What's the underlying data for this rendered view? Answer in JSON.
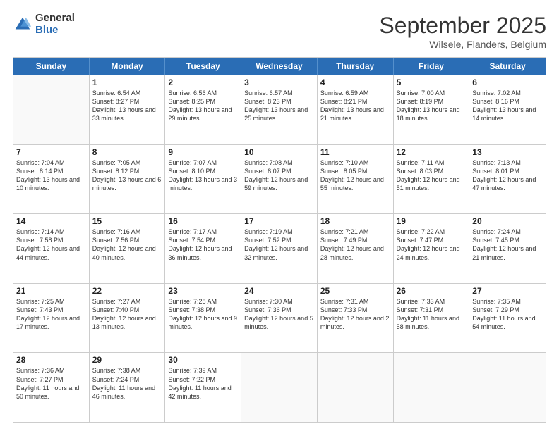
{
  "logo": {
    "general": "General",
    "blue": "Blue"
  },
  "title": {
    "month": "September 2025",
    "location": "Wilsele, Flanders, Belgium"
  },
  "days": [
    "Sunday",
    "Monday",
    "Tuesday",
    "Wednesday",
    "Thursday",
    "Friday",
    "Saturday"
  ],
  "weeks": [
    [
      {
        "day": "",
        "sunrise": "",
        "sunset": "",
        "daylight": ""
      },
      {
        "day": "1",
        "sunrise": "Sunrise: 6:54 AM",
        "sunset": "Sunset: 8:27 PM",
        "daylight": "Daylight: 13 hours and 33 minutes."
      },
      {
        "day": "2",
        "sunrise": "Sunrise: 6:56 AM",
        "sunset": "Sunset: 8:25 PM",
        "daylight": "Daylight: 13 hours and 29 minutes."
      },
      {
        "day": "3",
        "sunrise": "Sunrise: 6:57 AM",
        "sunset": "Sunset: 8:23 PM",
        "daylight": "Daylight: 13 hours and 25 minutes."
      },
      {
        "day": "4",
        "sunrise": "Sunrise: 6:59 AM",
        "sunset": "Sunset: 8:21 PM",
        "daylight": "Daylight: 13 hours and 21 minutes."
      },
      {
        "day": "5",
        "sunrise": "Sunrise: 7:00 AM",
        "sunset": "Sunset: 8:19 PM",
        "daylight": "Daylight: 13 hours and 18 minutes."
      },
      {
        "day": "6",
        "sunrise": "Sunrise: 7:02 AM",
        "sunset": "Sunset: 8:16 PM",
        "daylight": "Daylight: 13 hours and 14 minutes."
      }
    ],
    [
      {
        "day": "7",
        "sunrise": "Sunrise: 7:04 AM",
        "sunset": "Sunset: 8:14 PM",
        "daylight": "Daylight: 13 hours and 10 minutes."
      },
      {
        "day": "8",
        "sunrise": "Sunrise: 7:05 AM",
        "sunset": "Sunset: 8:12 PM",
        "daylight": "Daylight: 13 hours and 6 minutes."
      },
      {
        "day": "9",
        "sunrise": "Sunrise: 7:07 AM",
        "sunset": "Sunset: 8:10 PM",
        "daylight": "Daylight: 13 hours and 3 minutes."
      },
      {
        "day": "10",
        "sunrise": "Sunrise: 7:08 AM",
        "sunset": "Sunset: 8:07 PM",
        "daylight": "Daylight: 12 hours and 59 minutes."
      },
      {
        "day": "11",
        "sunrise": "Sunrise: 7:10 AM",
        "sunset": "Sunset: 8:05 PM",
        "daylight": "Daylight: 12 hours and 55 minutes."
      },
      {
        "day": "12",
        "sunrise": "Sunrise: 7:11 AM",
        "sunset": "Sunset: 8:03 PM",
        "daylight": "Daylight: 12 hours and 51 minutes."
      },
      {
        "day": "13",
        "sunrise": "Sunrise: 7:13 AM",
        "sunset": "Sunset: 8:01 PM",
        "daylight": "Daylight: 12 hours and 47 minutes."
      }
    ],
    [
      {
        "day": "14",
        "sunrise": "Sunrise: 7:14 AM",
        "sunset": "Sunset: 7:58 PM",
        "daylight": "Daylight: 12 hours and 44 minutes."
      },
      {
        "day": "15",
        "sunrise": "Sunrise: 7:16 AM",
        "sunset": "Sunset: 7:56 PM",
        "daylight": "Daylight: 12 hours and 40 minutes."
      },
      {
        "day": "16",
        "sunrise": "Sunrise: 7:17 AM",
        "sunset": "Sunset: 7:54 PM",
        "daylight": "Daylight: 12 hours and 36 minutes."
      },
      {
        "day": "17",
        "sunrise": "Sunrise: 7:19 AM",
        "sunset": "Sunset: 7:52 PM",
        "daylight": "Daylight: 12 hours and 32 minutes."
      },
      {
        "day": "18",
        "sunrise": "Sunrise: 7:21 AM",
        "sunset": "Sunset: 7:49 PM",
        "daylight": "Daylight: 12 hours and 28 minutes."
      },
      {
        "day": "19",
        "sunrise": "Sunrise: 7:22 AM",
        "sunset": "Sunset: 7:47 PM",
        "daylight": "Daylight: 12 hours and 24 minutes."
      },
      {
        "day": "20",
        "sunrise": "Sunrise: 7:24 AM",
        "sunset": "Sunset: 7:45 PM",
        "daylight": "Daylight: 12 hours and 21 minutes."
      }
    ],
    [
      {
        "day": "21",
        "sunrise": "Sunrise: 7:25 AM",
        "sunset": "Sunset: 7:43 PM",
        "daylight": "Daylight: 12 hours and 17 minutes."
      },
      {
        "day": "22",
        "sunrise": "Sunrise: 7:27 AM",
        "sunset": "Sunset: 7:40 PM",
        "daylight": "Daylight: 12 hours and 13 minutes."
      },
      {
        "day": "23",
        "sunrise": "Sunrise: 7:28 AM",
        "sunset": "Sunset: 7:38 PM",
        "daylight": "Daylight: 12 hours and 9 minutes."
      },
      {
        "day": "24",
        "sunrise": "Sunrise: 7:30 AM",
        "sunset": "Sunset: 7:36 PM",
        "daylight": "Daylight: 12 hours and 5 minutes."
      },
      {
        "day": "25",
        "sunrise": "Sunrise: 7:31 AM",
        "sunset": "Sunset: 7:33 PM",
        "daylight": "Daylight: 12 hours and 2 minutes."
      },
      {
        "day": "26",
        "sunrise": "Sunrise: 7:33 AM",
        "sunset": "Sunset: 7:31 PM",
        "daylight": "Daylight: 11 hours and 58 minutes."
      },
      {
        "day": "27",
        "sunrise": "Sunrise: 7:35 AM",
        "sunset": "Sunset: 7:29 PM",
        "daylight": "Daylight: 11 hours and 54 minutes."
      }
    ],
    [
      {
        "day": "28",
        "sunrise": "Sunrise: 7:36 AM",
        "sunset": "Sunset: 7:27 PM",
        "daylight": "Daylight: 11 hours and 50 minutes."
      },
      {
        "day": "29",
        "sunrise": "Sunrise: 7:38 AM",
        "sunset": "Sunset: 7:24 PM",
        "daylight": "Daylight: 11 hours and 46 minutes."
      },
      {
        "day": "30",
        "sunrise": "Sunrise: 7:39 AM",
        "sunset": "Sunset: 7:22 PM",
        "daylight": "Daylight: 11 hours and 42 minutes."
      },
      {
        "day": "",
        "sunrise": "",
        "sunset": "",
        "daylight": ""
      },
      {
        "day": "",
        "sunrise": "",
        "sunset": "",
        "daylight": ""
      },
      {
        "day": "",
        "sunrise": "",
        "sunset": "",
        "daylight": ""
      },
      {
        "day": "",
        "sunrise": "",
        "sunset": "",
        "daylight": ""
      }
    ]
  ]
}
